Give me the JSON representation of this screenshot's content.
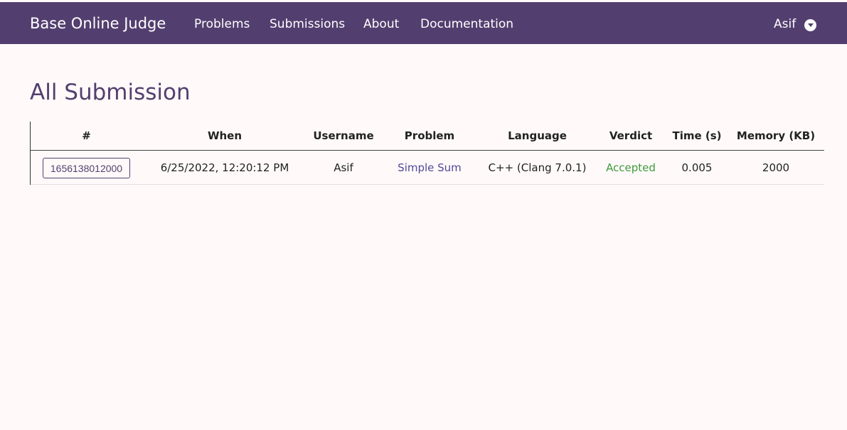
{
  "navbar": {
    "brand": "Base Online Judge",
    "links": [
      "Problems",
      "Submissions",
      "About",
      "Documentation"
    ],
    "user": "Asif",
    "user_menu_icon": "chevron-down-circle-icon"
  },
  "main": {
    "title": "All Submission",
    "table": {
      "headers": [
        "#",
        "When",
        "Username",
        "Problem",
        "Language",
        "Verdict",
        "Time (s)",
        "Memory (KB)"
      ],
      "rows": [
        {
          "id": "1656138012000",
          "when": "6/25/2022, 12:20:12 PM",
          "username": "Asif",
          "problem": "Simple Sum",
          "language": "C++ (Clang 7.0.1)",
          "verdict": "Accepted",
          "time": "0.005",
          "memory": "2000"
        }
      ]
    }
  },
  "colors": {
    "navbar": "#533f6f",
    "background": "#fffaf9",
    "accent": "#533f6f",
    "accepted": "#3f9a3a"
  }
}
